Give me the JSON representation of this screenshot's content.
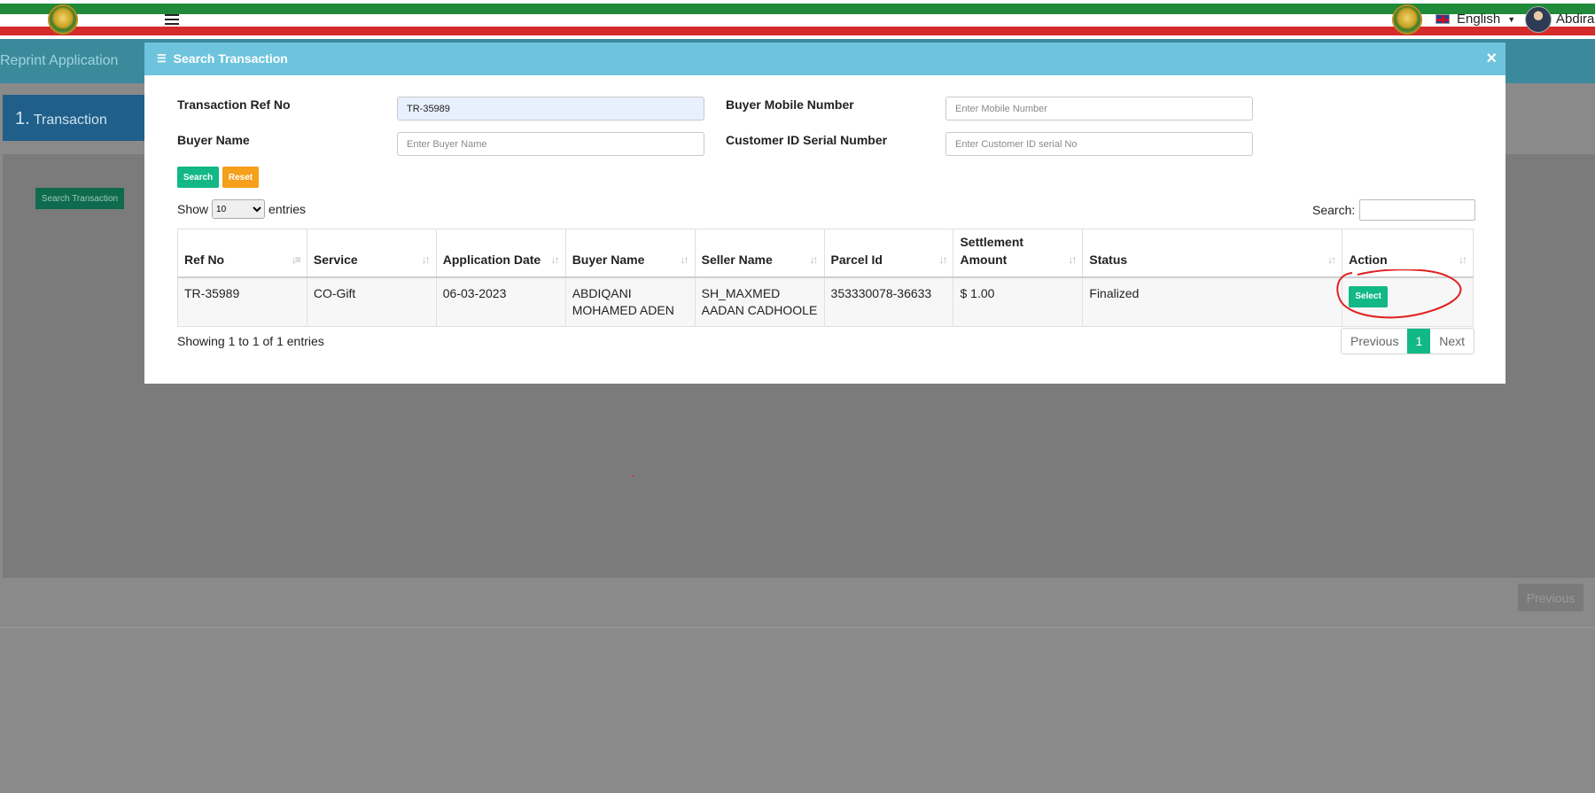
{
  "topbar": {
    "language": "English",
    "user_name": "Abdirahman"
  },
  "page": {
    "title": "Reprint Application",
    "step": {
      "number": "1.",
      "label": "Transaction"
    },
    "search_transaction_button": "Search Transaction",
    "previous_button": "Previous"
  },
  "modal": {
    "title": "Search Transaction",
    "close_label": "×",
    "fields": {
      "ref_label": "Transaction Ref No",
      "ref_value": "TR-35989",
      "mobile_label": "Buyer Mobile Number",
      "mobile_placeholder": "Enter Mobile Number",
      "buyer_label": "Buyer Name",
      "buyer_placeholder": "Enter Buyer Name",
      "customer_id_label": "Customer ID Serial Number",
      "customer_id_placeholder": "Enter Customer ID serial No"
    },
    "buttons": {
      "search": "Search",
      "reset": "Reset"
    },
    "table_controls": {
      "show_label": "Show",
      "entries_label": "entries",
      "page_size": "10",
      "search_label": "Search:"
    },
    "columns": [
      "Ref No",
      "Service",
      "Application Date",
      "Buyer Name",
      "Seller Name",
      "Parcel Id",
      "Settlement Amount",
      "Status",
      "Action"
    ],
    "rows": [
      {
        "ref_no": "TR-35989",
        "service": "CO-Gift",
        "application_date": "06-03-2023",
        "buyer_name": "ABDIQANI MOHAMED ADEN",
        "seller_name": "SH_MAXMED AADAN CADHOOLE",
        "parcel_id": "353330078-36633",
        "settlement_amount": "$ 1.00",
        "status": "Finalized",
        "action": "Select"
      }
    ],
    "info": "Showing 1 to 1 of 1 entries",
    "pagination": {
      "previous": "Previous",
      "current": "1",
      "next": "Next"
    }
  },
  "colors": {
    "modal_header": "#6ec4dd",
    "primary_green": "#12b886",
    "reset_orange": "#f59f1b",
    "annotation_red": "#e02020"
  }
}
